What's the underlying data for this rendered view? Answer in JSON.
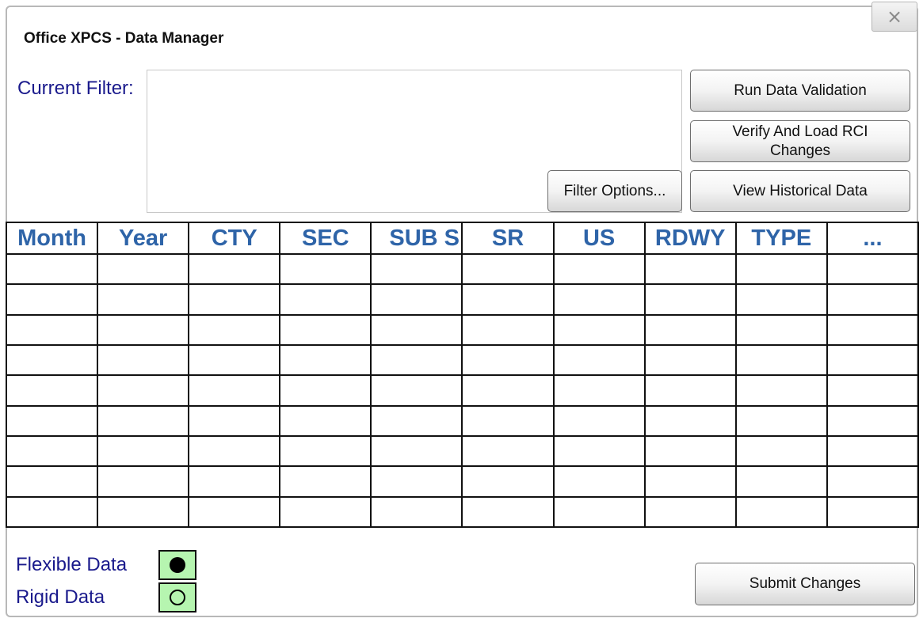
{
  "window": {
    "title": "Office XPCS - Data Manager",
    "close_glyph": "×"
  },
  "filter": {
    "label": "Current Filter:",
    "value": "",
    "options_button": "Filter Options..."
  },
  "actions": {
    "run_validation": "Run Data Validation",
    "verify_load_line1": "Verify And Load RCI",
    "verify_load_line2": "Changes",
    "view_historical": "View Historical Data",
    "submit": "Submit Changes"
  },
  "table": {
    "columns": [
      "Month",
      "Year",
      "CTY",
      "SEC",
      "SUB S",
      "SR",
      "US",
      "RDWY",
      "TYPE",
      "..."
    ],
    "rows": [
      [
        "",
        "",
        "",
        "",
        "",
        "",
        "",
        "",
        "",
        ""
      ],
      [
        "",
        "",
        "",
        "",
        "",
        "",
        "",
        "",
        "",
        ""
      ],
      [
        "",
        "",
        "",
        "",
        "",
        "",
        "",
        "",
        "",
        ""
      ],
      [
        "",
        "",
        "",
        "",
        "",
        "",
        "",
        "",
        "",
        ""
      ],
      [
        "",
        "",
        "",
        "",
        "",
        "",
        "",
        "",
        "",
        ""
      ],
      [
        "",
        "",
        "",
        "",
        "",
        "",
        "",
        "",
        "",
        ""
      ],
      [
        "",
        "",
        "",
        "",
        "",
        "",
        "",
        "",
        "",
        ""
      ],
      [
        "",
        "",
        "",
        "",
        "",
        "",
        "",
        "",
        "",
        ""
      ],
      [
        "",
        "",
        "",
        "",
        "",
        "",
        "",
        "",
        "",
        ""
      ]
    ]
  },
  "legend": {
    "flexible": {
      "label": "Flexible Data",
      "selected": true,
      "color": "#b6f5b0"
    },
    "rigid": {
      "label": "Rigid Data",
      "selected": false,
      "color": "#b6f5b0"
    }
  },
  "colors": {
    "label_text": "#1a1a8c",
    "header_text": "#2e64a8"
  }
}
